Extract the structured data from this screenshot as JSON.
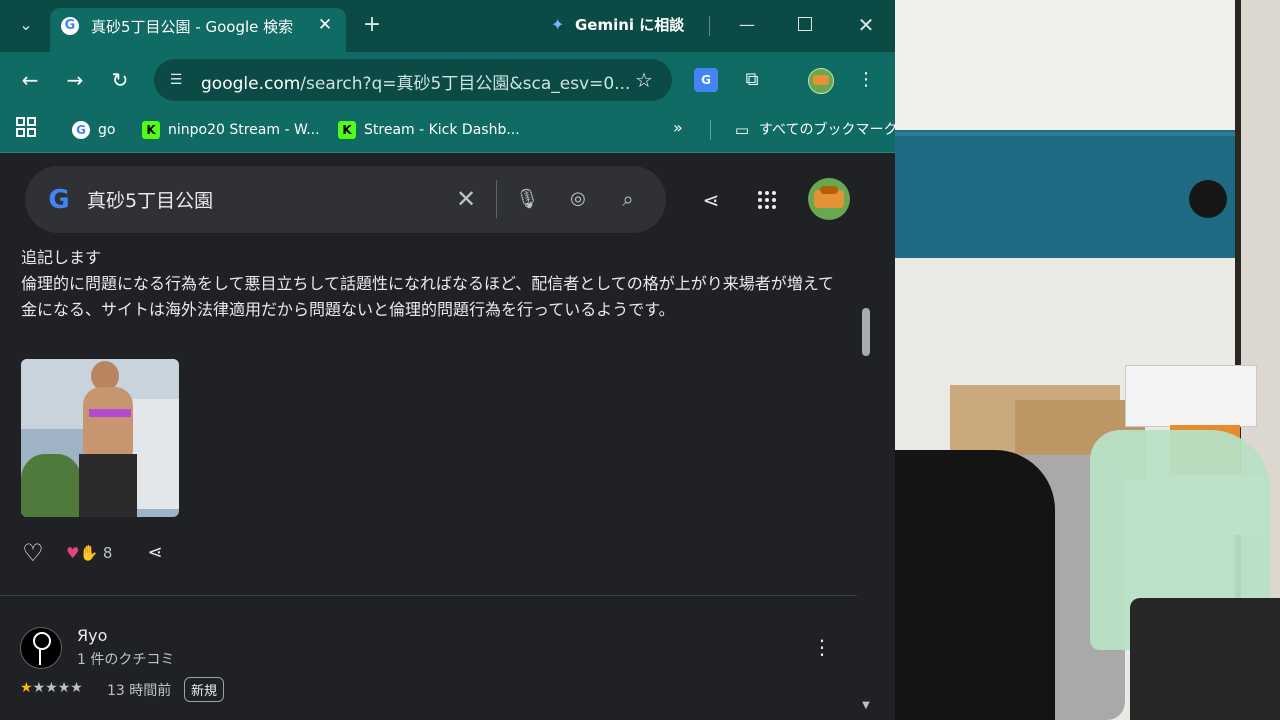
{
  "browser": {
    "tab": {
      "favicon": "G",
      "title": "真砂5丁目公園 - Google 検索"
    },
    "gemini_label": "Gemini に相談",
    "omnibox": {
      "url_main": "google.com",
      "url_rest": "/search?q=真砂5丁目公園&sca_esv=0..."
    },
    "bookmarks": [
      {
        "label": "go",
        "icon": "G"
      },
      {
        "label": "ninpo20 Stream - W...",
        "icon": "K"
      },
      {
        "label": "Stream - Kick Dashb...",
        "icon": "K"
      }
    ],
    "all_bookmarks_label": "すべてのブックマーク",
    "colors": {
      "frame": "#0b4a45",
      "toolbar": "#0f6b63",
      "page_bg": "#202124"
    }
  },
  "search": {
    "query": "真砂5丁目公園"
  },
  "review1": {
    "text": "追記します\n倫理的に問題になる行為をして悪目立ちして話題性になればなるほど、配信者としての格が上がり来場者が増えて金になる、サイトは海外法律適用だから問題ないと倫理的問題行為を行っているようです。",
    "reaction_count": "8"
  },
  "review2": {
    "author": "Яyo",
    "meta": "1 件のクチコミ",
    "rating": 1,
    "stars": [
      "★",
      "★",
      "★",
      "★",
      "★"
    ],
    "time": "13 時間前",
    "badge": "新規"
  }
}
